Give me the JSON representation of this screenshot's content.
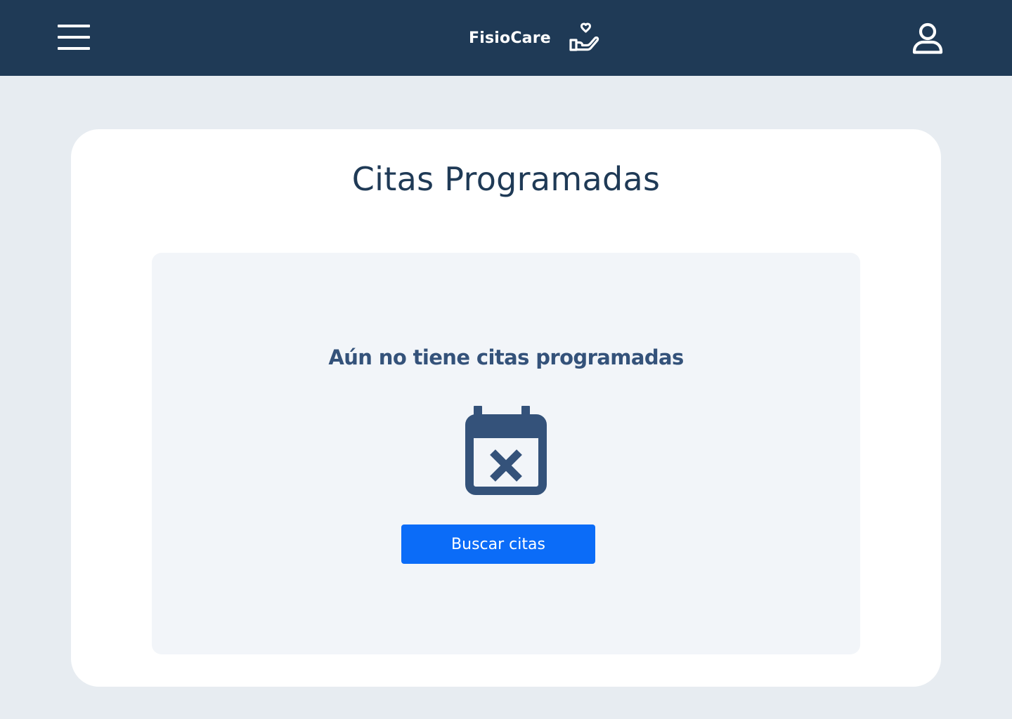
{
  "header": {
    "brand_name": "FisioCare",
    "brand_icon": "hand-holding-heart-icon",
    "menu_icon": "hamburger-menu-icon",
    "user_icon": "user-profile-icon",
    "background_color": "#1f3a56"
  },
  "page": {
    "title": "Citas Programadas",
    "background_color": "#e7ecf1"
  },
  "empty_state": {
    "message": "Aún no tiene citas programadas",
    "icon": "calendar-x-icon",
    "button_label": "Buscar citas",
    "button_color": "#0b6cf8"
  }
}
